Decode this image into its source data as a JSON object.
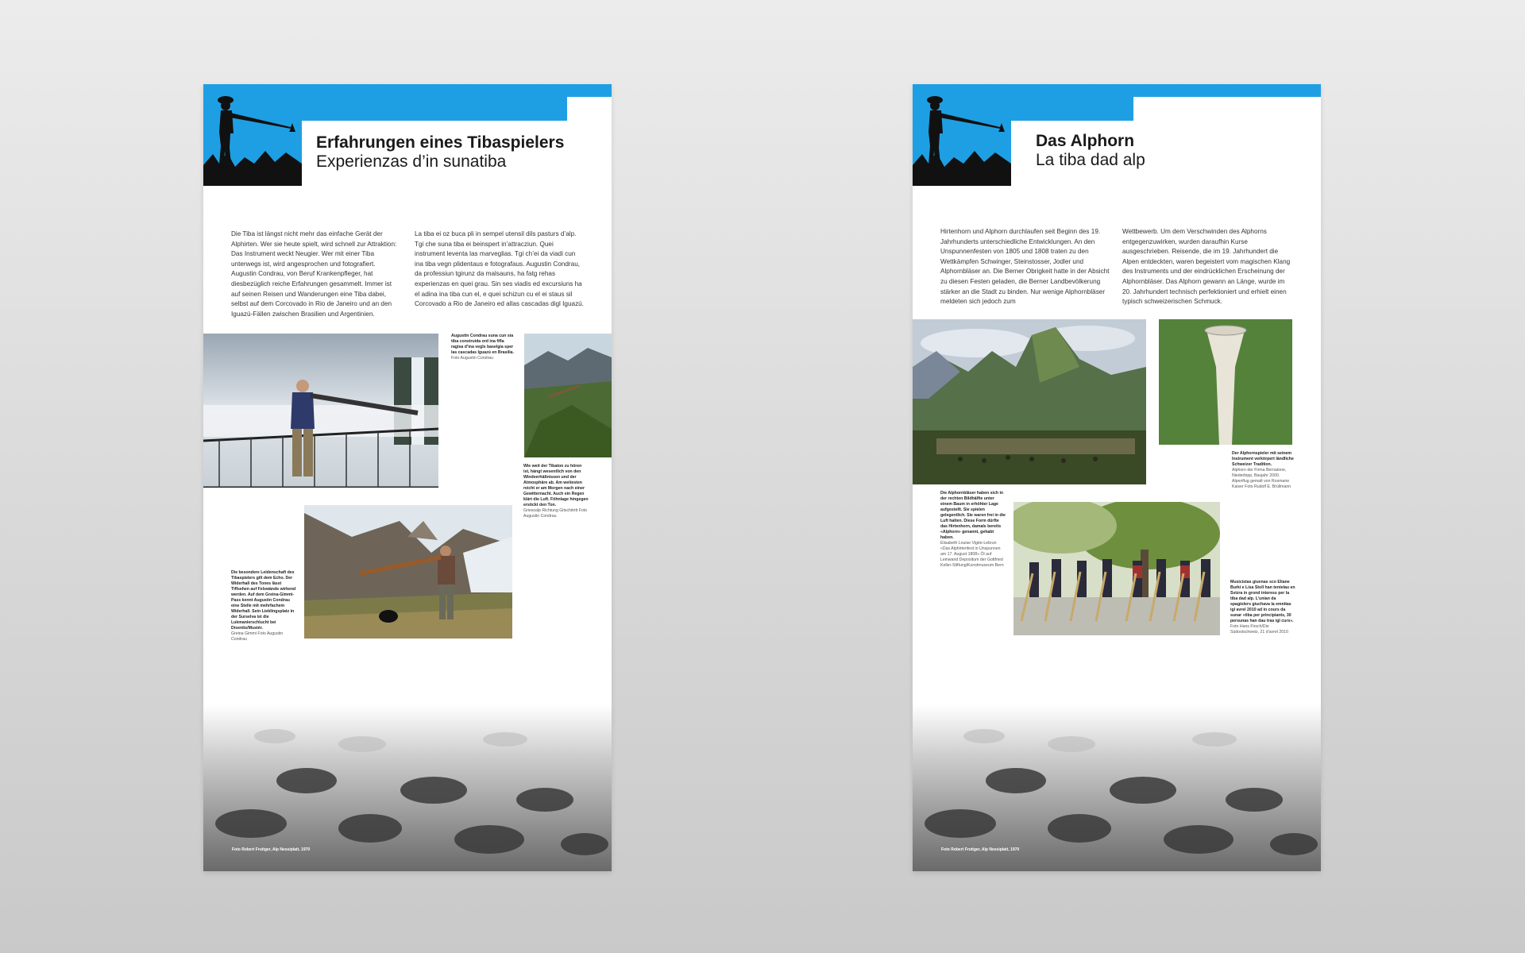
{
  "left_panel": {
    "title_de": "Erfahrungen eines Tibaspielers",
    "title_rm": "Experienzas d’in sunatiba",
    "text_de": "Die Tiba ist längst nicht mehr das einfache Gerät der Alphirten. Wer sie heute spielt, wird schnell zur Attraktion: Das Instrument weckt Neugier. Wer mit einer Tiba unterwegs ist, wird angesprochen und fotografiert. Augustin Condrau, von Beruf Krankenpfleger, hat diesbezüglich reiche Erfahrungen gesammelt. Immer ist auf seinen Reisen und Wanderungen eine Tiba dabei, selbst auf dem Corcovado in Rio de Janeiro und an den Iguazú-Fällen zwischen Brasilien und Argentinien.",
    "text_rm": "La tiba ei oz buca pli in sempel utensil dils pasturs d’alp. Tgi che suna tiba ei beinspert in’attracziun. Quei instrument leventa las marveglias. Tgi ch’ei da viadi cun ina tiba vegn plidentaus e fotografaus. Augustin Condrau, da professiun tgirunz da malsauns, ha fatg rehas experienzas en quei grau. Sin ses viadis ed excursiuns ha el adina ina tiba cun el, e quei schizun cu el ei staus sil Corcovado a Rio de Janeiro ed allas cascadas digl Iguazú.",
    "captions": [
      {
        "text": "Augustin Condrau suna cun sia tiba construida ord ina fifla ragisa d’ina vegls baselgia sper las cascadas Iguazú en Brasilia.",
        "credit": "Foto Augustin Condrau"
      },
      {
        "text": "Wie weit der Tibaton zu hören ist, hängt wesentlich von den Windverhältnissen und der Atmosphäre ab. Am weitesten reicht er am Morgen nach einer Gewitternacht. Auch ein Regen klärt die Luft. Föhnlage hingegen erstickt den Ton.",
        "credit": "Griessalp Richtung Gitschitritt Foto Augustin Condrau"
      },
      {
        "text": "Die besondere Leidenschaft des Tibaspielers gilt dem Echo. Der Widerhall des Tones lässt Tiffsehen auf Felswände wirkend werden. Auf dem Greina-Gimmi-Pass kennt Augustin Condrau eine Stelle mit mehrfachem Widerhall. Sein Lieblingsplatz in der Surselva ist die Lukmanierschlucht bei Disentis/Mustér.",
        "credit": "Greina Gimmi Foto Augustin Condrau"
      }
    ],
    "bottom_credit": "Foto Robert Frutiger, Alp Nessiplatt, 1970"
  },
  "right_panel": {
    "title_de": "Das Alphorn",
    "title_rm": "La tiba dad alp",
    "text_1": "Hirtenhorn und Alphorn durchlaufen seit Beginn des 19. Jahrhunderts unterschiedliche Entwicklungen. An den Unspunnenfesten von 1805 und 1808 traten zu den Wettkämpfen Schwinger, Steinstosser, Jodler und Alphornbläser an. Die Berner Obrigkeit hatte in der Absicht zu diesen Festen geladen, die Berner Landbevölkerung stärker an die Stadt zu binden. Nur wenige Alphornbläser meldeten sich jedoch zum",
    "text_2": "Wettbewerb. Um dem Verschwinden des Alphorns entgegenzuwirken, wurden daraufhin Kurse ausgeschrieben. Reisende, die im 19. Jahrhundert die Alpen entdeckten, waren begeistert vom magischen Klang des Instruments und der eindrücklichen Erscheinung der Alphornbläser. Das Alphorn gewann an Länge, wurde im 20. Jahrhundert technisch perfektioniert und erhielt einen typisch schweizerischen Schmuck.",
    "captions": [
      {
        "text": "Der Alphornspieler mit seinem Instrument verkörpert ländliche Schweizer Tradition.",
        "credit": "Alphorn der Firma Bernatone, Niederbipp, Baujahr 2000. Alpenflug gemalt von Rosmarie Kaiser Foto Rudolf E. Brüllmann"
      },
      {
        "text": "Die Alphornbläser haben sich in der rechten Bildhälfte unter einem Baum in erhöhter Lage aufgestellt. Sie spielen gelegentlich. Sie waren frei in die Luft halten. Diese Form dürfte das Hirtenhorn, damals bereits «Alphorn» genannt, gehabt haben.",
        "credit": "Elisabeth Louise Vigée-Lebrun «Das Alphirtenfest in Unspunnen am 17. August 1808» Öl auf Leinwand Depositum der Gottfried Keller-Stiftung/Kunstmuseum Bern"
      },
      {
        "text": "Musicistas giuvnas sco Eliane Burki e Lisa Stoll han tentelau en Svizra in grond interess per la tiba dad alp. L’unian da spagiolers giuchava la emnitas igl avrel 2010 ad in cours da sunar «tiba per principiants, 30 persunas han dau tras igl curs».",
        "credit": "Foto Hans Firsch/Die Südostschweiz, 21 d’avrel 2010"
      }
    ],
    "bottom_credit": "Foto Robert Frutiger, Alp Nessiplatt, 1970"
  },
  "icons": {
    "logo": "alphorn-player-logo-icon"
  },
  "colors": {
    "accent_blue": "#1f9fe3",
    "panel_bg": "#ffffff"
  }
}
